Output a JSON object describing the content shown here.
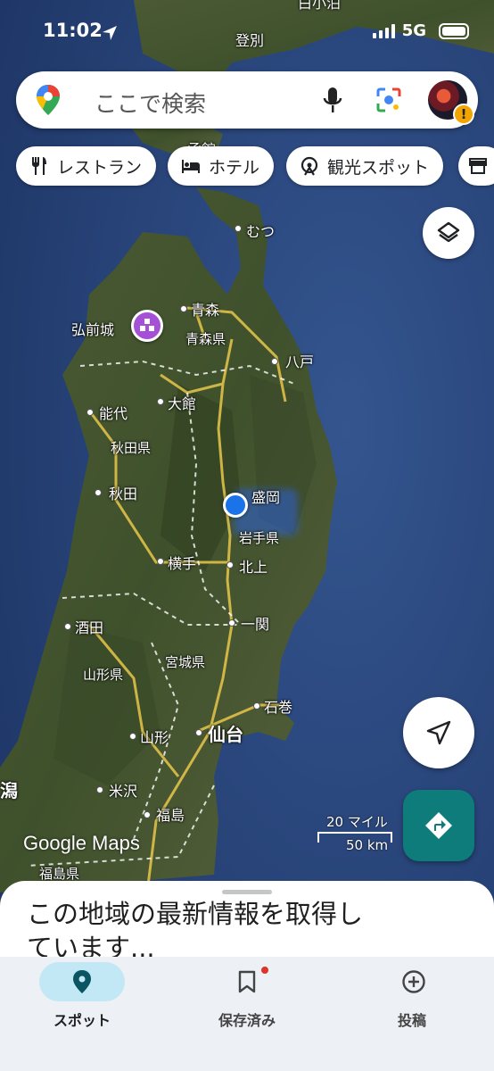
{
  "status": {
    "time": "11:02",
    "network": "5G"
  },
  "search": {
    "placeholder": "ここで検索"
  },
  "chips": [
    {
      "label": "レストラン",
      "icon": "restaurant-icon"
    },
    {
      "label": "ホテル",
      "icon": "hotel-icon"
    },
    {
      "label": "観光スポット",
      "icon": "attraction-icon"
    },
    {
      "label": "",
      "icon": "store-icon"
    }
  ],
  "map": {
    "labels": {
      "tomari": "白小泊",
      "noboribetsu": "登別",
      "hakodate": "函館",
      "mutsu": "むつ",
      "aomori": "青森",
      "aomori_pref": "青森県",
      "hirosakijo": "弘前城",
      "hachinohe": "八戸",
      "odate": "大館",
      "noshiro": "能代",
      "akita_pref": "秋田県",
      "akita": "秋田",
      "morioka": "盛岡",
      "iwate_pref": "岩手県",
      "yokote": "横手",
      "kitakami": "北上",
      "sakata": "酒田",
      "ichinoseki": "一関",
      "miyagi_pref": "宮城県",
      "yamagata_pref": "山形県",
      "ishinomaki": "石巻",
      "yamagata": "山形",
      "sendai": "仙台",
      "niigata": "潟",
      "yonezawa": "米沢",
      "fukushima": "福島",
      "fukushima_pref": "福島県"
    },
    "watermark": "Google Maps",
    "scale": {
      "top": "20 マイル",
      "bottom": "50 km"
    }
  },
  "sheet": {
    "text": "この地域の最新情報を取得しています..."
  },
  "nav": [
    {
      "label": "スポット",
      "icon": "pin-icon",
      "active": true
    },
    {
      "label": "保存済み",
      "icon": "bookmark-icon",
      "active": false
    },
    {
      "label": "投稿",
      "icon": "add-circle-icon",
      "active": false
    }
  ],
  "colors": {
    "accent": "#0e7c7b",
    "nav_active": "#c2e7f5",
    "location": "#1a73e8",
    "poi": "#a551d6"
  }
}
